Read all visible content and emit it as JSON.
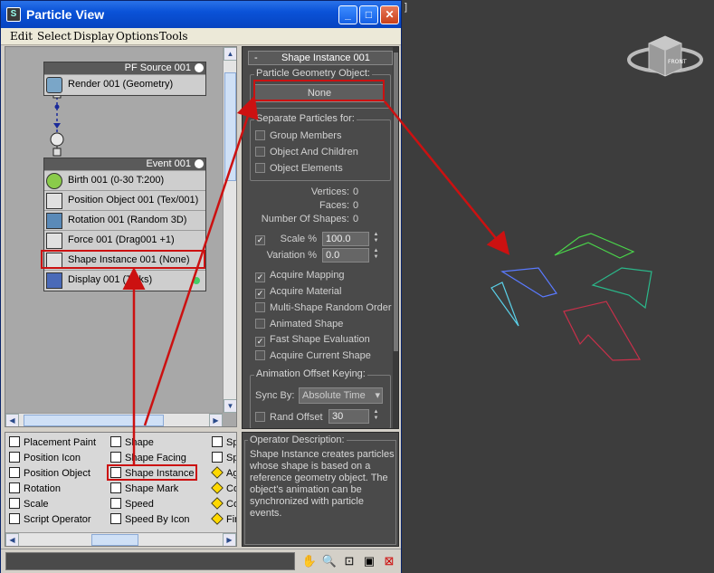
{
  "window": {
    "title": "Particle View",
    "buttons": {
      "minimize": "_",
      "maximize": "□",
      "close": "✕"
    }
  },
  "menu": [
    "Edit",
    "Select",
    "Display",
    "Options",
    "Tools"
  ],
  "graph": {
    "source_node": {
      "header": "PF Source 001",
      "operators": [
        {
          "label": "Render 001 (Geometry)",
          "icon": "render-teapot-icon"
        }
      ]
    },
    "event_node": {
      "header": "Event 001",
      "operators": [
        {
          "label": "Birth 001 (0-30 T:200)",
          "icon": "birth-icon"
        },
        {
          "label": "Position Object 001 (Tex/001)",
          "icon": "position-object-icon"
        },
        {
          "label": "Rotation 001 (Random 3D)",
          "icon": "rotation-icon"
        },
        {
          "label": "Force 001 (Drag001 +1)",
          "icon": "force-icon"
        },
        {
          "label": "Shape Instance 001 (None)",
          "icon": "shape-instance-icon"
        },
        {
          "label": "Display 001 (Ticks)",
          "icon": "display-icon"
        }
      ]
    }
  },
  "depot": {
    "col1": [
      "Placement Paint",
      "Position Icon",
      "Position Object",
      "Rotation",
      "Scale",
      "Script Operator"
    ],
    "col2": [
      "Shape",
      "Shape Facing",
      "Shape Instance",
      "Shape Mark",
      "Speed",
      "Speed By Icon"
    ],
    "col3": [
      "Sp",
      "Sp",
      "Ag",
      "Co",
      "Co",
      "Fir"
    ]
  },
  "panel": {
    "rollout_minus": "-",
    "rollout_title": "Shape Instance 001",
    "geometry_group": "Particle Geometry Object:",
    "geometry_button": "None",
    "separate_group": "Separate Particles for:",
    "separate_options": [
      {
        "label": "Group Members",
        "checked": false
      },
      {
        "label": "Object And Children",
        "checked": false
      },
      {
        "label": "Object Elements",
        "checked": false
      }
    ],
    "vertices_label": "Vertices:",
    "vertices_value": "0",
    "faces_label": "Faces:",
    "faces_value": "0",
    "shapes_label": "Number Of Shapes:",
    "shapes_value": "0",
    "scale_label": "Scale %",
    "scale_value": "100.0",
    "variation_label": "Variation %",
    "variation_value": "0.0",
    "options": [
      {
        "label": "Acquire Mapping",
        "checked": true
      },
      {
        "label": "Acquire Material",
        "checked": true
      },
      {
        "label": "Multi-Shape Random Order",
        "checked": false
      },
      {
        "label": "Animated Shape",
        "checked": false
      },
      {
        "label": "Fast Shape Evaluation",
        "checked": true
      },
      {
        "label": "Acquire Current Shape",
        "checked": false
      }
    ],
    "anim_group": "Animation Offset Keying:",
    "sync_label": "Sync By:",
    "sync_value": "Absolute Time",
    "rand_label": "Rand Offset",
    "rand_value": "30"
  },
  "description": {
    "title": "Operator Description:",
    "text": "Shape Instance creates particles whose shape is based on a reference geometry object. The object's animation can be synchronized with particle events."
  },
  "viewport": {
    "bracket": "]",
    "cube_text": "FRONT"
  },
  "colors": {
    "annotation": "#cc1111",
    "titlebar": "#0a52d8"
  }
}
